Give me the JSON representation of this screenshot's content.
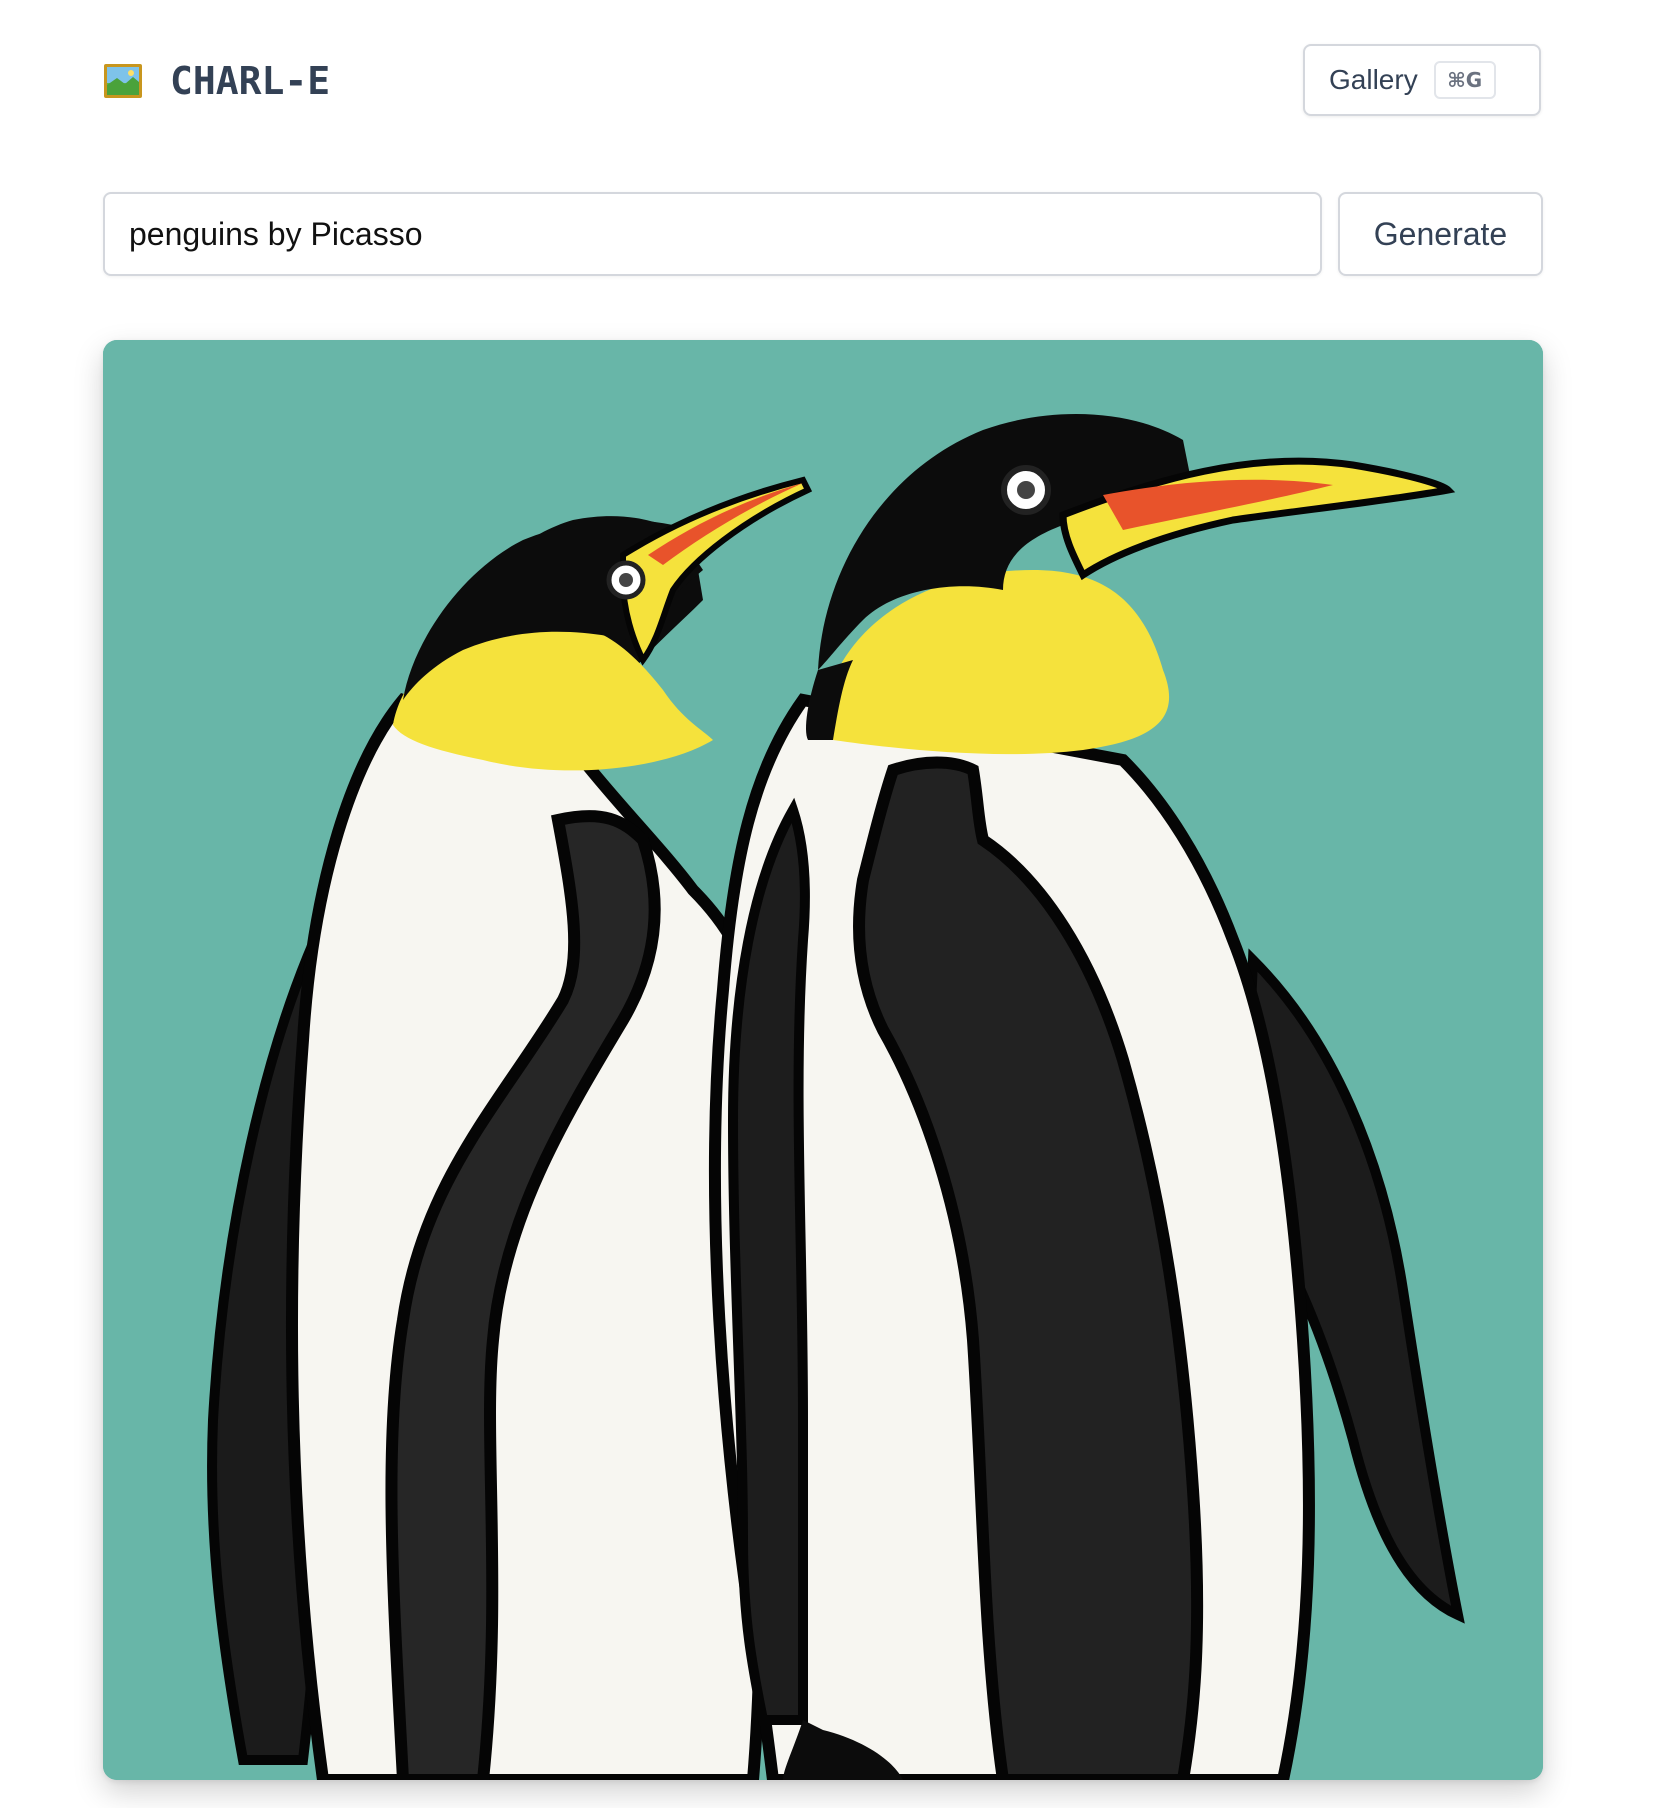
{
  "app": {
    "title": "CHARL-E",
    "logo_icon": "framed-picture-icon"
  },
  "header": {
    "gallery_label": "Gallery",
    "gallery_shortcut": "⌘G"
  },
  "prompt": {
    "value": "penguins by Picasso",
    "generate_label": "Generate"
  },
  "result": {
    "description_icon": "generated-image",
    "background_color": "#6ab7a9"
  }
}
